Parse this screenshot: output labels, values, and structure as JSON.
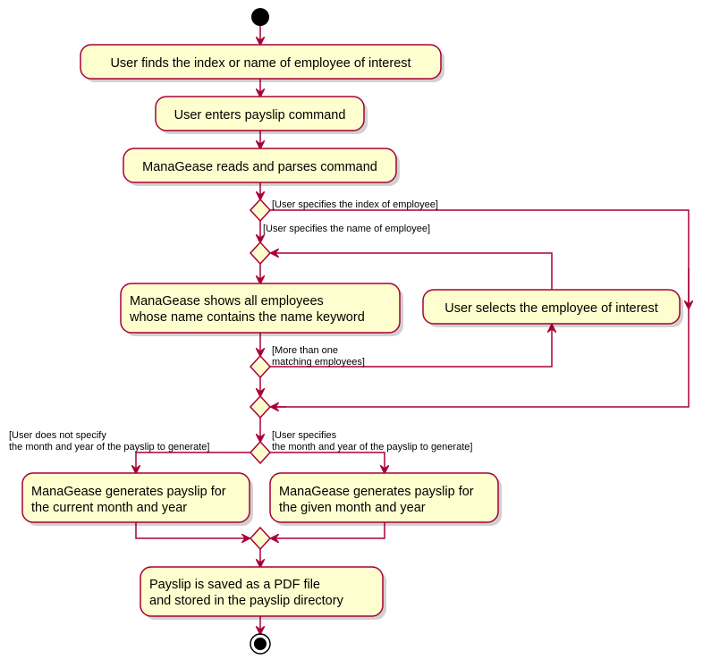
{
  "colors": {
    "border": "#A80036",
    "fill": "#FEFECE",
    "node": "#000000"
  },
  "activities": {
    "find": "User finds the index or name of employee of interest",
    "enter": "User enters payslip command",
    "parse": "ManaGease reads and parses command",
    "show_1": "ManaGease shows all employees",
    "show_2": "whose name contains the name keyword",
    "select": "User selects the employee of interest",
    "gen_current_1": "ManaGease generates payslip for",
    "gen_current_2": "the current month and year",
    "gen_given_1": "ManaGease generates payslip for",
    "gen_given_2": "the given month and year",
    "save_1": "Payslip is saved as a PDF file",
    "save_2": "and stored in the payslip directory"
  },
  "guards": {
    "index": "[User specifies the index of employee]",
    "name": "[User specifies the name of employee]",
    "more_1": "[More than one",
    "more_2": "matching employees]",
    "nospec_1": "[User does not specify",
    "nospec_2": "the month and year of the payslip to generate]",
    "spec_1": "[User specifies",
    "spec_2": "the month and year of the payslip to generate]"
  }
}
